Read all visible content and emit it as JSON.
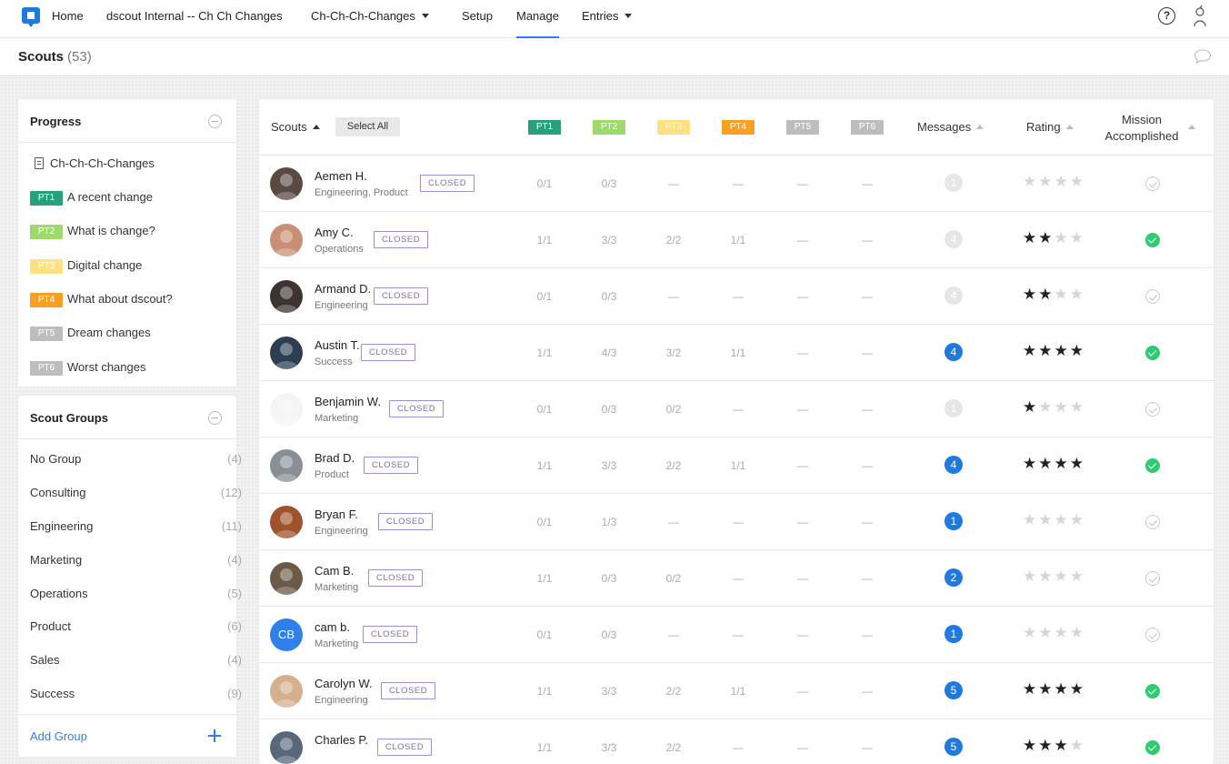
{
  "nav": {
    "home": "Home",
    "study": "dscout Internal -- Ch Ch Changes",
    "mission": "Ch-Ch-Ch-Changes",
    "setup": "Setup",
    "manage": "Manage",
    "entries": "Entries",
    "help_glyph": "?"
  },
  "header": {
    "title": "Scouts",
    "count": "(53)"
  },
  "colors": {
    "accent": "#2f80ed",
    "pt1": "#26a17b",
    "pt2": "#9dd96b",
    "pt3": "#ffe082",
    "pt4": "#f7a022",
    "pt5": "#bdbdbd",
    "pt6": "#bdbdbd",
    "closed": "#7b6fc0",
    "complete": "#2ecc71"
  },
  "progress": {
    "title": "Progress",
    "mission_name": "Ch-Ch-Ch-Changes",
    "parts": [
      {
        "badge": "PT1",
        "label": "A recent change"
      },
      {
        "badge": "PT2",
        "label": "What is change?"
      },
      {
        "badge": "PT3",
        "label": "Digital change"
      },
      {
        "badge": "PT4",
        "label": "What about dscout?"
      },
      {
        "badge": "PT5",
        "label": "Dream changes"
      },
      {
        "badge": "PT6",
        "label": "Worst changes"
      }
    ]
  },
  "groups": {
    "title": "Scout Groups",
    "items": [
      {
        "name": "No Group",
        "count": "(4)"
      },
      {
        "name": "Consulting",
        "count": "(12)"
      },
      {
        "name": "Engineering",
        "count": "(11)"
      },
      {
        "name": "Marketing",
        "count": "(4)"
      },
      {
        "name": "Operations",
        "count": "(5)"
      },
      {
        "name": "Product",
        "count": "(6)"
      },
      {
        "name": "Sales",
        "count": "(4)"
      },
      {
        "name": "Success",
        "count": "(9)"
      }
    ],
    "add_label": "Add Group"
  },
  "table": {
    "col_scouts": "Scouts",
    "select_all": "Select All",
    "pt_headers": [
      "PT1",
      "PT2",
      "PT3",
      "PT4",
      "PT5",
      "PT6"
    ],
    "col_messages": "Messages",
    "col_rating": "Rating",
    "col_mission_1": "Mission",
    "col_mission_2": "Accomplished",
    "closed_label": "CLOSED",
    "rows": [
      {
        "name": "Aemen H.",
        "group": "Engineering, Product",
        "pts": [
          "0/1",
          "0/3",
          "—",
          "—",
          "—",
          "—"
        ],
        "messages": "1",
        "msg_style": "grey",
        "rating": 0,
        "done": false
      },
      {
        "name": "Amy C.",
        "group": "Operations",
        "pts": [
          "1/1",
          "3/3",
          "2/2",
          "1/1",
          "—",
          "—"
        ],
        "messages": "4",
        "msg_style": "grey",
        "rating": 2,
        "done": true
      },
      {
        "name": "Armand D.",
        "group": "Engineering",
        "pts": [
          "0/1",
          "0/3",
          "—",
          "—",
          "—",
          "—"
        ],
        "messages": "4",
        "msg_style": "grey",
        "rating": 2,
        "done": false
      },
      {
        "name": "Austin T.",
        "group": "Success",
        "pts": [
          "1/1",
          "4/3",
          "3/2",
          "1/1",
          "—",
          "—"
        ],
        "messages": "4",
        "msg_style": "blue",
        "rating": 4,
        "done": true
      },
      {
        "name": "Benjamin W.",
        "group": "Marketing",
        "pts": [
          "0/1",
          "0/3",
          "0/2",
          "—",
          "—",
          "—"
        ],
        "messages": "1",
        "msg_style": "grey",
        "rating": 1,
        "done": false
      },
      {
        "name": "Brad D.",
        "group": "Product",
        "pts": [
          "1/1",
          "3/3",
          "2/2",
          "1/1",
          "—",
          "—"
        ],
        "messages": "4",
        "msg_style": "blue",
        "rating": 4,
        "done": true
      },
      {
        "name": "Bryan F.",
        "group": "Engineering",
        "pts": [
          "0/1",
          "1/3",
          "—",
          "—",
          "—",
          "—"
        ],
        "messages": "1",
        "msg_style": "blue",
        "rating": 0,
        "done": false
      },
      {
        "name": "Cam B.",
        "group": "Marketing",
        "pts": [
          "1/1",
          "0/3",
          "0/2",
          "—",
          "—",
          "—"
        ],
        "messages": "2",
        "msg_style": "blue",
        "rating": 0,
        "done": false
      },
      {
        "name": "cam b.",
        "group": "Marketing",
        "initials": "CB",
        "pts": [
          "0/1",
          "0/3",
          "—",
          "—",
          "—",
          "—"
        ],
        "messages": "1",
        "msg_style": "blue",
        "rating": 0,
        "done": false
      },
      {
        "name": "Carolyn W.",
        "group": "Engineering",
        "pts": [
          "1/1",
          "3/3",
          "2/2",
          "1/1",
          "—",
          "—"
        ],
        "messages": "5",
        "msg_style": "blue",
        "rating": 4,
        "done": true
      },
      {
        "name": "Charles P.",
        "group": "",
        "pts": [
          "1/1",
          "3/3",
          "2/2",
          "—",
          "—",
          "—"
        ],
        "messages": "5",
        "msg_style": "blue",
        "rating": 3,
        "done": true
      }
    ]
  }
}
